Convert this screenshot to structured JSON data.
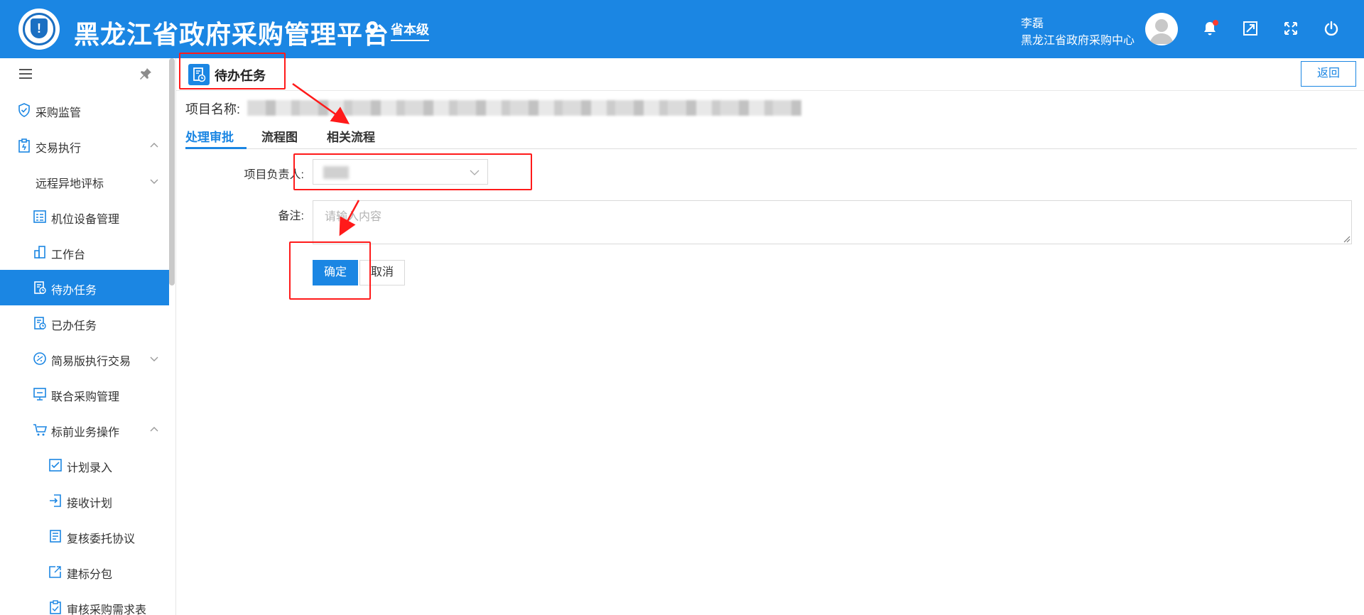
{
  "header": {
    "app_title": "黑龙江省政府采购管理平台",
    "location": "省本级",
    "user_name": "李磊",
    "user_org": "黑龙江省政府采购中心"
  },
  "sidebar": {
    "items": [
      {
        "label": "采购监管",
        "icon": "shield-check-icon"
      },
      {
        "label": "交易执行",
        "icon": "clipboard-icon"
      },
      {
        "label": "远程异地评标"
      },
      {
        "label": "机位设备管理",
        "icon": "device-list-icon"
      },
      {
        "label": "工作台",
        "icon": "workbench-icon"
      },
      {
        "label": "待办任务",
        "icon": "todo-task-icon"
      },
      {
        "label": "已办任务",
        "icon": "done-task-icon"
      },
      {
        "label": "简易版执行交易",
        "icon": "simple-trade-icon"
      },
      {
        "label": "联合采购管理",
        "icon": "joint-purchase-icon"
      },
      {
        "label": "标前业务操作",
        "icon": "cart-icon"
      },
      {
        "label": "计划录入",
        "icon": "plan-entry-icon"
      },
      {
        "label": "接收计划",
        "icon": "receive-plan-icon"
      },
      {
        "label": "复核委托协议",
        "icon": "agreement-icon"
      },
      {
        "label": "建标分包",
        "icon": "package-icon"
      },
      {
        "label": "审核采购需求表",
        "icon": "review-demand-icon"
      }
    ]
  },
  "page": {
    "title": "待办任务",
    "back_label": "返回",
    "project_name_label": "项目名称:",
    "tabs": [
      "处理审批",
      "流程图",
      "相关流程"
    ],
    "form": {
      "owner_label": "项目负责人:",
      "remark_label": "备注:",
      "remark_placeholder": "请输入内容",
      "confirm_label": "确定",
      "cancel_label": "取消"
    }
  },
  "colors": {
    "primary": "#1b86e3",
    "annotation_red": "#ff1a1a"
  }
}
